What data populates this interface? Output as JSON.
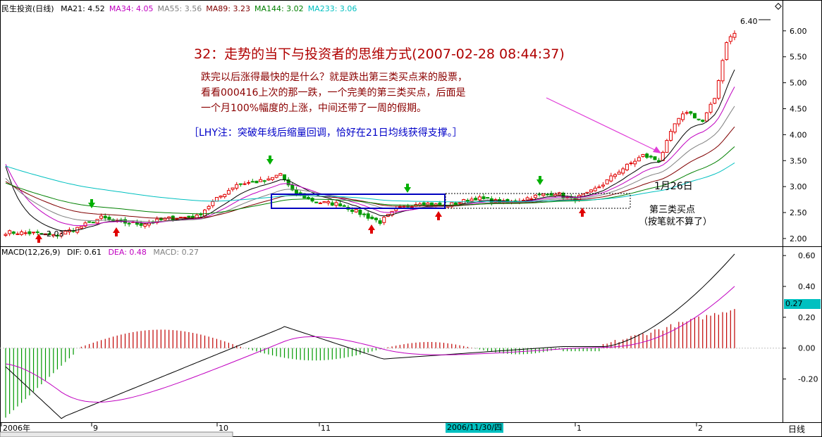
{
  "header": {
    "stock_label": "民生投资(日线)",
    "ma_items": [
      {
        "label": "MA21: 4.52",
        "color": "#000000"
      },
      {
        "label": "MA34: 4.05",
        "color": "#c000c0"
      },
      {
        "label": "MA55: 3.56",
        "color": "#808080"
      },
      {
        "label": "MA89: 3.23",
        "color": "#800000"
      },
      {
        "label": "MA144: 3.02",
        "color": "#008000"
      },
      {
        "label": "MA233: 3.06",
        "color": "#00c0c0"
      }
    ]
  },
  "annotations": {
    "title": "32：走势的当下与投资者的思维方式(2007-02-28 08:44:37)",
    "body": [
      "跌完以后涨得最快的是什么？就是跌出第三类买点来的股票，",
      "看看000416上次的那一跌，一个完美的第三类买点，后面是",
      "一个月100%幅度的上涨，中间还带了一周的假期。"
    ],
    "lhy_note": "［LHY注：突破年线后缩量回调，恰好在21日均线获得支撑。］",
    "date_mark": "1月26日",
    "third_buy": "第三类买点",
    "third_buy_sub": "（按笔就不算了）",
    "high_label": "6.40",
    "low_label": "2.03"
  },
  "macd_header": {
    "label": "MACD(12,26,9)",
    "dif": "DIF: 0.61",
    "dea": "DEA: 0.48",
    "macd": "MACD: 0.27",
    "current_value": "0.27"
  },
  "x_axis": {
    "labels": [
      "2006年",
      "9",
      "10",
      "11",
      "1",
      "2"
    ],
    "cursor_date": "2006/11/30/四",
    "period_button": "日线"
  },
  "chart_data": [
    {
      "type": "candlestick",
      "title": "民生投资(日线)",
      "ylim": [
        1.85,
        6.35
      ],
      "y_ticks": [
        "6.00",
        "5.50",
        "5.00",
        "4.50",
        "4.00",
        "3.50",
        "3.00",
        "2.50",
        "2.00"
      ],
      "grid": false,
      "series_names": [
        "MA21",
        "MA34",
        "MA55",
        "MA89",
        "MA144",
        "MA233"
      ]
    },
    {
      "type": "bar",
      "title": "MACD(12,26,9)",
      "ylim": [
        -0.48,
        0.66
      ],
      "y_ticks": [
        "0.60",
        "0.40",
        "0.20",
        "0.00",
        "-0.20"
      ],
      "series_names": [
        "DIF",
        "DEA",
        "MACD"
      ]
    }
  ],
  "colors": {
    "up": "#e00000",
    "down": "#009900",
    "axis": "#000000",
    "box": "#0000c0",
    "arrow": "#e03cd8",
    "note_red": "#8b0000",
    "note_blue": "#0000c8",
    "cursor_bg": "#00c0c0"
  }
}
